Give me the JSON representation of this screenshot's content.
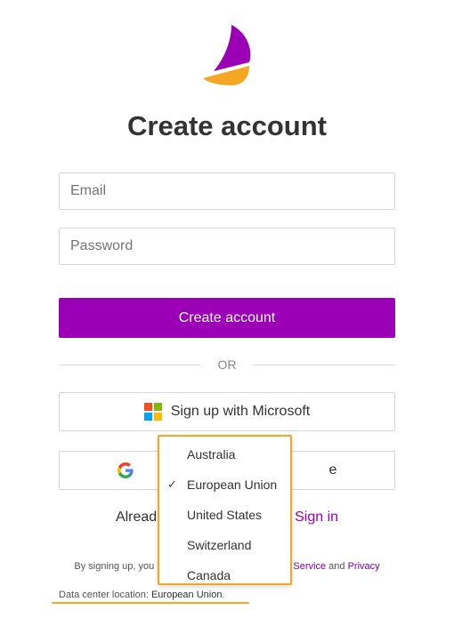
{
  "page": {
    "title": "Create account"
  },
  "form": {
    "email_placeholder": "Email",
    "password_placeholder": "Password",
    "submit_label": "Create account"
  },
  "divider": {
    "text": "OR"
  },
  "social": {
    "microsoft_label": "Sign up with Microsoft",
    "google_label": "e"
  },
  "signin": {
    "prefix": "Alread",
    "link": "Sign in"
  },
  "terms": {
    "prefix": "By signing up, you",
    "service_link": "Service",
    "and": "and",
    "privacy_link": "Privacy"
  },
  "datacenter": {
    "label": "Data center location:",
    "value": "European Union",
    "suffix": "."
  },
  "dropdown": {
    "options": [
      "Australia",
      "European Union",
      "United States",
      "Switzerland",
      "Canada"
    ],
    "checkmark": "✓",
    "selected": "European Union"
  },
  "colors": {
    "accent": "#9b00b7",
    "highlight": "#f5a623",
    "logo_top": "#9b00b7",
    "logo_bottom": "#f5a623"
  },
  "icons": [
    "logo-icon",
    "microsoft-icon",
    "google-icon",
    "checkmark-icon"
  ]
}
